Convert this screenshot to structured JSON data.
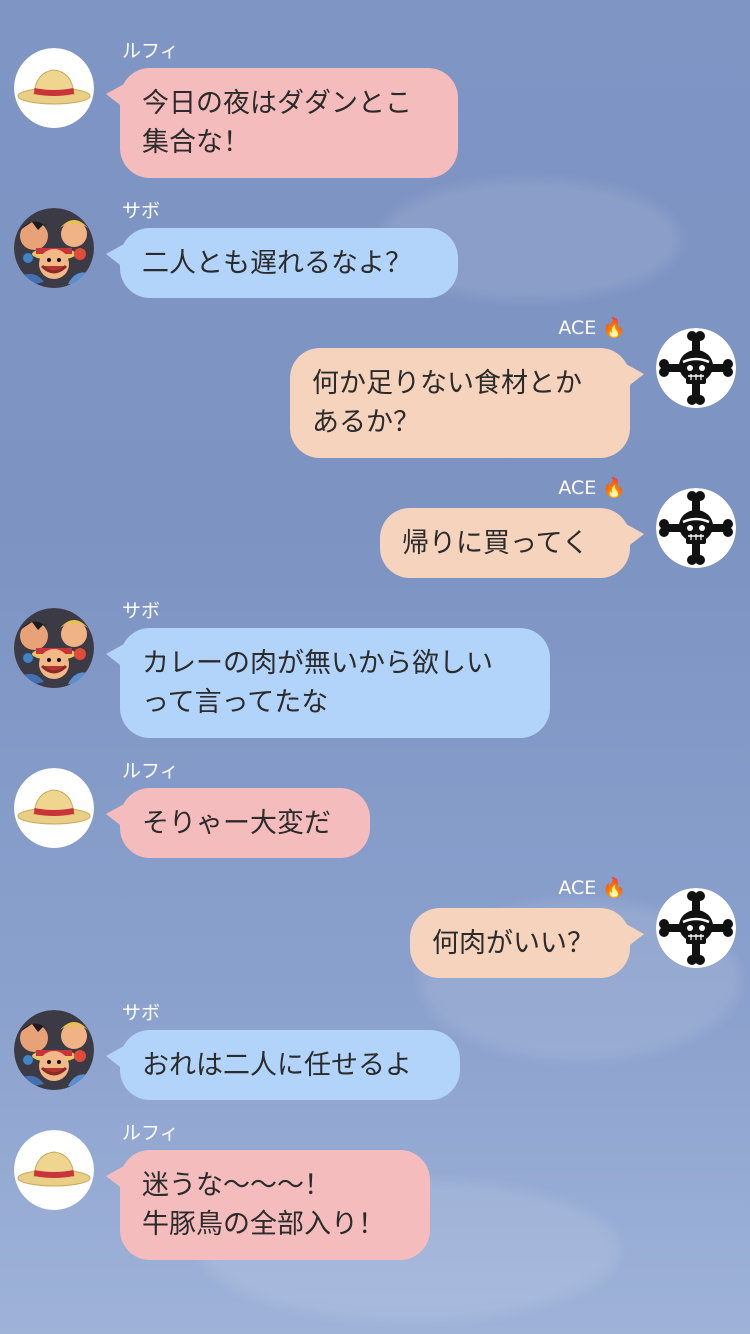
{
  "colors": {
    "luffy_bubble": "#f5bcbd",
    "sabo_bubble": "#b3d4fa",
    "ace_bubble": "#f6d3bd",
    "background": "#7f95c4",
    "name_text": "#ffffff"
  },
  "messages": [
    {
      "sender": "ルフィ",
      "side": "left",
      "avatar": "straw-hat-icon",
      "lines": [
        "今日の夜はダダンとこ",
        "集合な！"
      ]
    },
    {
      "sender": "サボ",
      "side": "left",
      "avatar": "brothers-avatar",
      "lines": [
        "二人とも遅れるなよ？"
      ]
    },
    {
      "sender": "ACE",
      "side": "right",
      "avatar": "jolly-roger-icon",
      "badge": "🔥",
      "lines": [
        "何か足りない食材とか",
        "あるか？"
      ]
    },
    {
      "sender": "ACE",
      "side": "right",
      "avatar": "jolly-roger-icon",
      "badge": "🔥",
      "lines": [
        "帰りに買ってく"
      ]
    },
    {
      "sender": "サボ",
      "side": "left",
      "avatar": "brothers-avatar",
      "lines": [
        "カレーの肉が無いから欲しい",
        "って言ってたな"
      ]
    },
    {
      "sender": "ルフィ",
      "side": "left",
      "avatar": "straw-hat-icon",
      "lines": [
        "そりゃー大変だ"
      ]
    },
    {
      "sender": "ACE",
      "side": "right",
      "avatar": "jolly-roger-icon",
      "badge": "🔥",
      "lines": [
        "何肉がいい？"
      ]
    },
    {
      "sender": "サボ",
      "side": "left",
      "avatar": "brothers-avatar",
      "lines": [
        "おれは二人に任せるよ"
      ]
    },
    {
      "sender": "ルフィ",
      "side": "left",
      "avatar": "straw-hat-icon",
      "lines": [
        "迷うな〜〜〜！",
        "牛豚鳥の全部入り！"
      ]
    }
  ]
}
